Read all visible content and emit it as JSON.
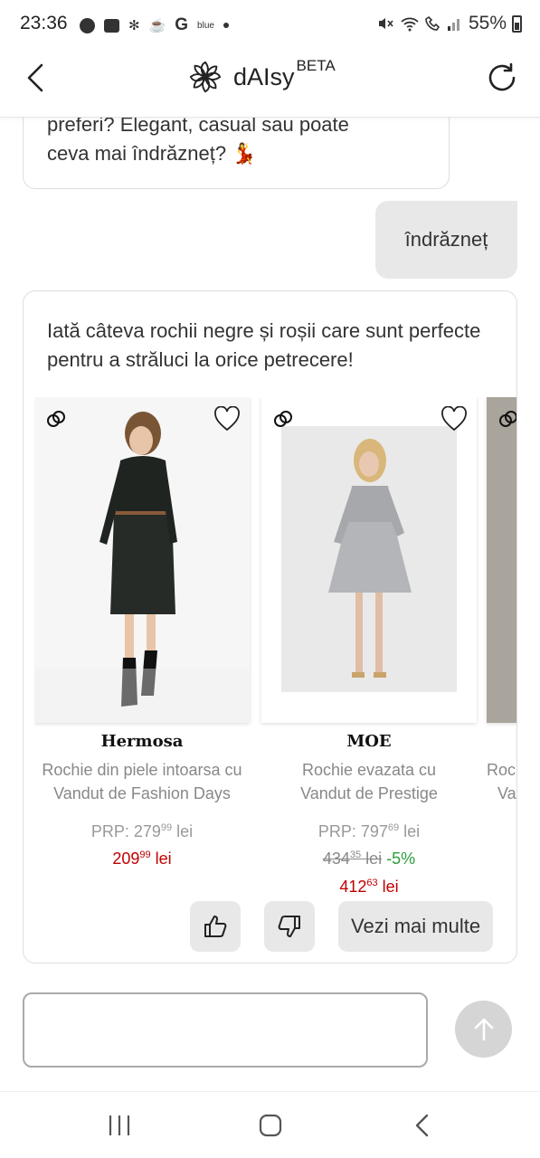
{
  "status_bar": {
    "time": "23:36",
    "carrier_label": "blue",
    "google_label": "G",
    "battery": "55%"
  },
  "header": {
    "app_name": "dAIsy",
    "badge": "BETA"
  },
  "chat": {
    "bot_message_1_line1": "preferi? Elegant, casual sau poate",
    "bot_message_1_line2": "ceva mai îndrăzneț? 💃",
    "user_message": "îndrăzneț",
    "bot_message_2": "Iată câteva rochii negre și roșii care sunt perfecte pentru a străluci la orice petrecere!"
  },
  "products": [
    {
      "brand": "Hermosa",
      "description": "Rochie din piele intoarsa cu",
      "seller": "Vandut de Fashion Days",
      "prp_label": "PRP: 279",
      "prp_decimals": "99",
      "prp_currency": "lei",
      "price": "209",
      "price_decimals": "99",
      "price_currency": "lei"
    },
    {
      "brand": "MOE",
      "description": "Rochie evazata cu",
      "seller": "Vandut de Prestige",
      "prp_label": "PRP: 797",
      "prp_decimals": "69",
      "prp_currency": "lei",
      "old_price": "434",
      "old_decimals": "35",
      "old_currency": "lei",
      "discount": "-5%",
      "price": "412",
      "price_decimals": "63",
      "price_currency": "lei"
    },
    {
      "description": "Roc",
      "seller": "Va"
    }
  ],
  "actions": {
    "more_label": "Vezi mai multe"
  },
  "colors": {
    "price_red": "#c00000",
    "discount_green": "#2a9d3a",
    "bubble_grey": "#e8e8e8"
  }
}
